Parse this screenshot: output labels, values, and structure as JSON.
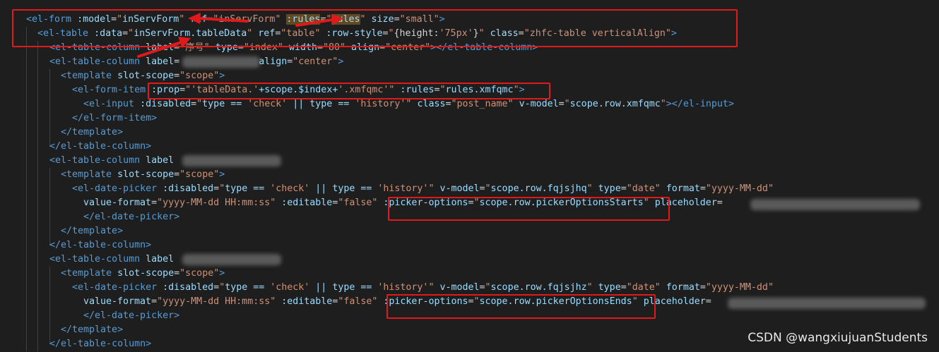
{
  "code": {
    "l1": {
      "tag": "el-form",
      "a1": ":model",
      "v1": "inServForm",
      "a2": "ref",
      "v2": "inServForm",
      "a3": ":rules",
      "v3": "rules",
      "a4": "size",
      "v4": "small"
    },
    "l2": {
      "tag": "el-table",
      "a1": ":data",
      "v1": "inServForm.tableData",
      "a2": "ref",
      "v2": "table",
      "a3": ":row-style",
      "v3a": "{height:",
      "v3b": "'75px'",
      "v3c": "}",
      "a4": "class",
      "v4": "zhfc-table verticalAlign"
    },
    "l3": {
      "tag": "el-table-column",
      "a1": "label",
      "v1": "序号",
      "a2": "type",
      "v2": "index",
      "a3": "width",
      "v3": "80",
      "a4": "align",
      "v4": "center",
      "close": "el-table-column"
    },
    "l4": {
      "tag": "el-table-column",
      "a1": "label",
      "a2": "align",
      "v2": "center"
    },
    "l5": {
      "tag": "template",
      "a1": "slot-scope",
      "v1": "scope"
    },
    "l6": {
      "tag": "el-form-item",
      "a1": ":prop",
      "v1a": "'tableData.'",
      "v1b": "+scope.$index+",
      "v1c": "'.xmfqmc'",
      "a2": ":rules",
      "v2": "rules.xmfqmc"
    },
    "l7": {
      "tag": "el-input",
      "a1": ":disabled",
      "v1a": "type == ",
      "v1b": "'check'",
      "v1c": " || type == ",
      "v1d": "'history'",
      "a2": "class",
      "v2": "post_name",
      "a3": "v-model",
      "v3": "scope.row.xmfqmc",
      "close": "el-input"
    },
    "l8": {
      "close": "el-form-item"
    },
    "l9": {
      "close": "template"
    },
    "l10": {
      "close": "el-table-column"
    },
    "l11": {
      "tag": "el-table-column",
      "a1": "label"
    },
    "l12": {
      "tag": "template",
      "a1": "slot-scope",
      "v1": "scope"
    },
    "l13": {
      "tag": "el-date-picker",
      "a1": ":disabled",
      "v1a": "type == ",
      "v1b": "'check'",
      "v1c": " || type == ",
      "v1d": "'history'",
      "a2": "v-model",
      "v2": "scope.row.fqjsjhq",
      "a3": "type",
      "v3": "date",
      "a4": "format",
      "v4": "yyyy-MM-dd"
    },
    "l14": {
      "a1": "value-format",
      "v1": "yyyy-MM-dd HH:mm:ss",
      "a2": ":editable",
      "v2": "false",
      "a3": ":picker-options",
      "v3": "scope.row.pickerOptionsStarts",
      "a4": "placeholder"
    },
    "l15": {
      "close": "el-date-picker"
    },
    "l16": {
      "close": "template"
    },
    "l17": {
      "close": "el-table-column"
    },
    "l18": {
      "tag": "el-table-column",
      "a1": "label"
    },
    "l19": {
      "tag": "template",
      "a1": "slot-scope",
      "v1": "scope"
    },
    "l20": {
      "tag": "el-date-picker",
      "a1": ":disabled",
      "v1a": "type == ",
      "v1b": "'check'",
      "v1c": " || type == ",
      "v1d": "'history'",
      "a2": "v-model",
      "v2": "scope.row.fqjsjhz",
      "a3": "type",
      "v3": "date",
      "a4": "format",
      "v4": "yyyy-MM-dd"
    },
    "l21": {
      "a1": "value-format",
      "v1": "yyyy-MM-dd HH:mm:ss",
      "a2": ":editable",
      "v2": "false",
      "a3": ":picker-options",
      "v3": "scope.row.pickerOptionsEnds",
      "a4": "placeholder"
    },
    "l22": {
      "close": "el-date-picker"
    },
    "l23": {
      "close": "template"
    },
    "l24": {
      "close": "el-table-column"
    }
  },
  "watermark": "CSDN @wangxiujuanStudents",
  "colors": {
    "tag": "#569cd6",
    "attr": "#9cdcfe",
    "string": "#ce9178",
    "background": "#1e1e1e",
    "annotation": "#e0191b"
  }
}
